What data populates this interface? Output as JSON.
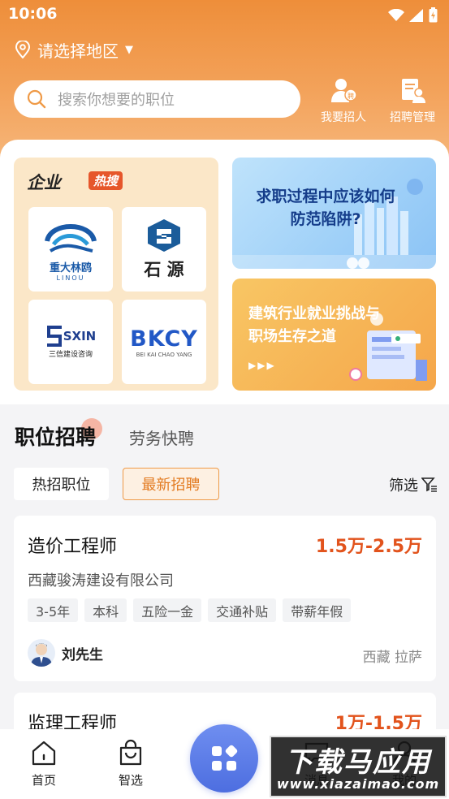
{
  "status_bar": {
    "time": "10:06"
  },
  "location": {
    "label": "请选择地区"
  },
  "search": {
    "placeholder": "搜索你想要的职位"
  },
  "header_actions": [
    {
      "label": "我要招人",
      "icon": "recruit-person-icon"
    },
    {
      "label": "招聘管理",
      "icon": "recruit-manage-icon"
    }
  ],
  "enterprise": {
    "title": "企业",
    "badge": "热搜",
    "logos": [
      {
        "name": "重大林鸥",
        "sub": "LINOU"
      },
      {
        "name": "石 源",
        "sub": ""
      },
      {
        "name": "SXIN",
        "sub": "三信建设咨询"
      },
      {
        "name": "BKCY",
        "sub": "BEI KAI CHAO YANG"
      }
    ]
  },
  "banners": [
    {
      "line1": "求职过程中应该如何",
      "line2": "防范陷阱?"
    },
    {
      "line1": "建筑行业就业挑战与",
      "line2": "职场生存之道",
      "arrows": "▶▶▶"
    }
  ],
  "tabs": {
    "active": "职位招聘",
    "other": "劳务快聘"
  },
  "chips": {
    "hot": "热招职位",
    "latest": "最新招聘"
  },
  "filter": {
    "label": "筛选"
  },
  "jobs": [
    {
      "title": "造价工程师",
      "salary": "1.5万-2.5万",
      "company": "西藏骏涛建设有限公司",
      "tags": [
        "3-5年",
        "本科",
        "五险一金",
        "交通补贴",
        "带薪年假"
      ],
      "recruiter": "刘先生",
      "location": "西藏 拉萨"
    },
    {
      "title": "监理工程师",
      "salary": "1万-1.5万"
    }
  ],
  "nav": {
    "home": "首页",
    "smart": "智选",
    "msg": "消息",
    "mine": "我的"
  },
  "watermark": {
    "line1": "下载马应用",
    "line2": "www.xiazaimao.com"
  },
  "colors": {
    "accent": "#ef9a47",
    "salary": "#e2531c",
    "center_button": "#5a7ae6"
  }
}
